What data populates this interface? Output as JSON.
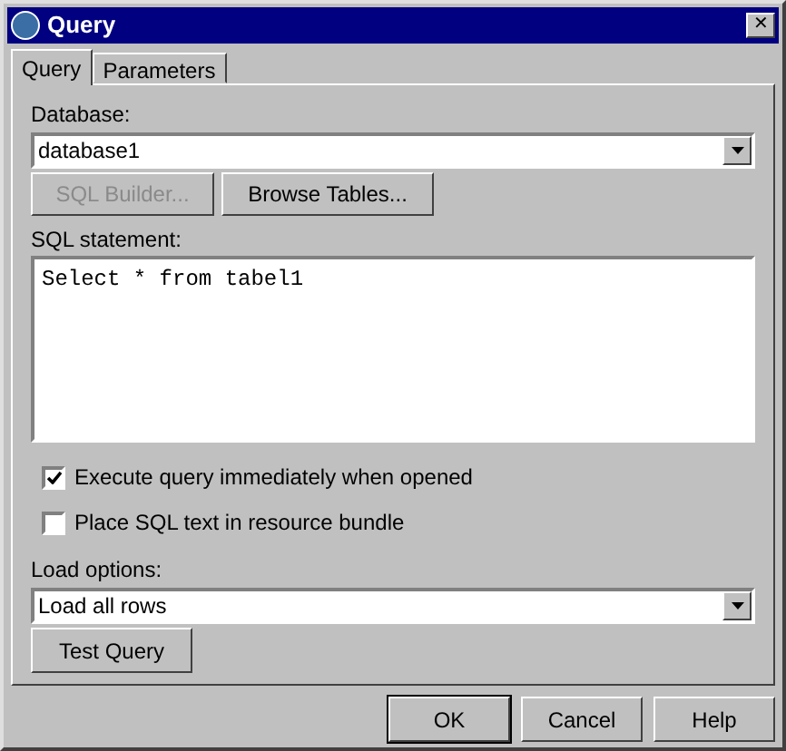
{
  "window": {
    "title": "Query",
    "close": "✕"
  },
  "tabs": [
    {
      "label": "Query",
      "selected": true
    },
    {
      "label": "Parameters",
      "selected": false
    }
  ],
  "database": {
    "label": "Database:",
    "value": "database1"
  },
  "builder_buttons": [
    {
      "label": "SQL Builder...",
      "disabled": true
    },
    {
      "label": "Browse Tables...",
      "disabled": false
    }
  ],
  "sql": {
    "label": "SQL statement:",
    "value": "Select * from tabel1"
  },
  "options": [
    {
      "label": "Execute query immediately when opened",
      "checked": true
    },
    {
      "label": "Place SQL text in resource bundle",
      "checked": false
    }
  ],
  "load_options": {
    "label": "Load options:",
    "value": "Load all rows"
  },
  "test_button": "Test Query",
  "buttons": [
    {
      "label": "OK",
      "default": true
    },
    {
      "label": "Cancel",
      "default": false
    },
    {
      "label": "Help",
      "default": false
    }
  ]
}
